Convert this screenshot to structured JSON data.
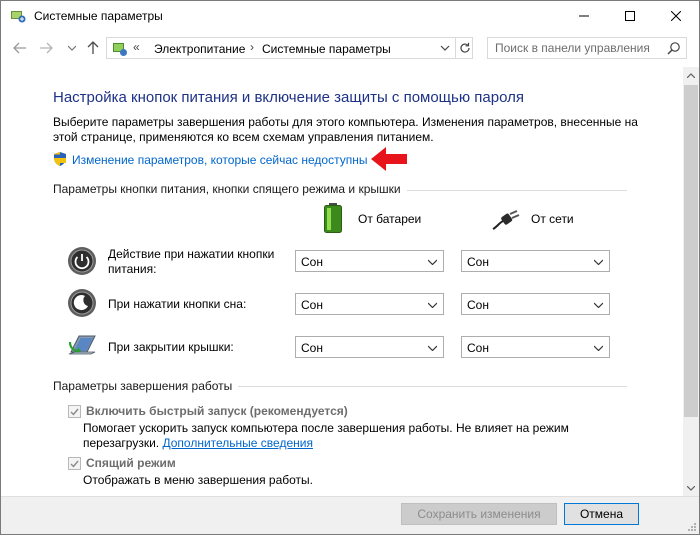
{
  "window": {
    "title": "Системные параметры"
  },
  "breadcrumb": {
    "prefix": "«",
    "items": [
      "Электропитание",
      "Системные параметры"
    ],
    "separator": "›"
  },
  "search": {
    "placeholder": "Поиск в панели управления"
  },
  "page": {
    "heading": "Настройка кнопок питания и включение защиты с помощью пароля",
    "description": "Выберите параметры завершения работы для этого компьютера. Изменения параметров, внесенные на этой странице, применяются ко всем схемам управления питанием.",
    "unlock_link": "Изменение параметров, которые сейчас недоступны"
  },
  "power_section": {
    "title": "Параметры кнопки питания, кнопки спящего режима и крышки",
    "columns": {
      "battery": "От батареи",
      "ac": "От сети"
    },
    "rows": [
      {
        "label": "Действие при нажатии кнопки питания:",
        "battery": "Сон",
        "ac": "Сон",
        "icon": "power-button-icon"
      },
      {
        "label": "При нажатии кнопки сна:",
        "battery": "Сон",
        "ac": "Сон",
        "icon": "sleep-button-icon"
      },
      {
        "label": "При закрытии крышки:",
        "battery": "Сон",
        "ac": "Сон",
        "icon": "laptop-lid-icon"
      }
    ]
  },
  "shutdown_section": {
    "title": "Параметры завершения работы",
    "items": [
      {
        "label": "Включить быстрый запуск (рекомендуется)",
        "checked": true,
        "help_line1": "Помогает ускорить запуск компьютера после завершения работы. Не влияет на режим",
        "help_line2": "перезагрузки.",
        "help_link": "Дополнительные сведения"
      },
      {
        "label": "Спящий режим",
        "checked": true,
        "help_line1": "Отображать в меню завершения работы."
      }
    ]
  },
  "buttons": {
    "save": "Сохранить изменения",
    "cancel": "Отмена"
  },
  "colors": {
    "heading": "#1e3287",
    "link": "#0066cc",
    "annotation_arrow": "#e8141c"
  }
}
